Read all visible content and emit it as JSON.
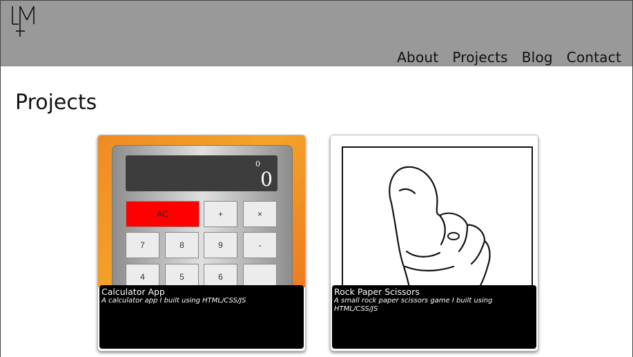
{
  "nav": {
    "items": [
      "About",
      "Projects",
      "Blog",
      "Contact"
    ]
  },
  "page": {
    "title": "Projects"
  },
  "projects": [
    {
      "title": "Calculator App",
      "description": "A calculator app I built using HTML/CSS/JS",
      "calculator": {
        "previous": "0",
        "current": "0",
        "keys": [
          "AC",
          "+",
          "×",
          "7",
          "8",
          "9",
          "-",
          "4",
          "5",
          "6",
          ""
        ]
      }
    },
    {
      "title": "Rock Paper Scissors",
      "description": "A small rock paper scissors game I built using HTML/CSS/JS"
    }
  ],
  "colors": {
    "header": "#999999",
    "caption_bg": "#000000",
    "ac_button": "#ff0000",
    "calc_gradient_orange": "#f4a428"
  },
  "icons": {
    "logo": "lm-monogram-logo"
  }
}
